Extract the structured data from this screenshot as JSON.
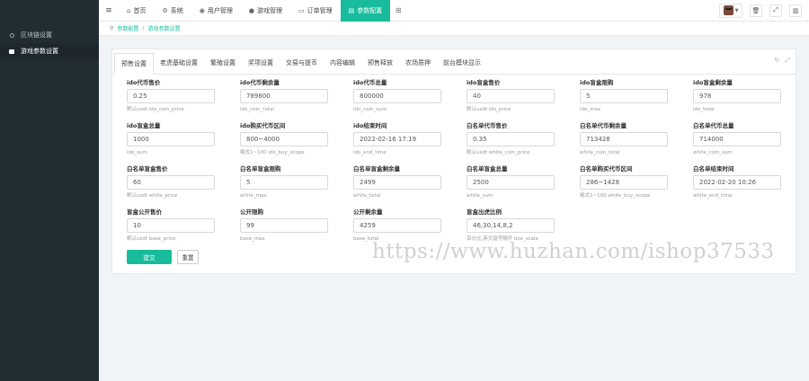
{
  "sidebar": {
    "items": [
      {
        "label": "区块链设置",
        "icon": "circle-icon",
        "active": false
      },
      {
        "label": "游戏参数设置",
        "icon": "box-icon",
        "active": true
      }
    ]
  },
  "topnav": {
    "items": [
      {
        "label": "首页",
        "icon": "home-icon",
        "glyph": "⌂",
        "active": false
      },
      {
        "label": "系统",
        "icon": "gear-icon",
        "glyph": "⚙",
        "active": false
      },
      {
        "label": "用户管理",
        "icon": "user-icon",
        "glyph": "◉",
        "active": false
      },
      {
        "label": "游戏管理",
        "icon": "game-icon",
        "glyph": "●",
        "active": false
      },
      {
        "label": "订单管理",
        "icon": "order-icon",
        "glyph": "▭",
        "active": false
      },
      {
        "label": "参数配置",
        "icon": "config-icon",
        "glyph": "▤",
        "active": true
      }
    ]
  },
  "breadcrumb": {
    "level1": "参数配置",
    "level2": "游戏参数设置"
  },
  "tabs": [
    "预售设置",
    "老虎基础设置",
    "繁殖设置",
    "奖项设置",
    "交易与提币",
    "内容编辑",
    "预售释放",
    "农场质押",
    "前台模块显示"
  ],
  "active_tab": 0,
  "fields": [
    {
      "label": "ido代币售价",
      "value": "0.25",
      "hint": "默认usdt ido_coin_price"
    },
    {
      "label": "ido代币剩余量",
      "value": "789800",
      "hint": "ido_coin_total"
    },
    {
      "label": "ido代币总量",
      "value": "800000",
      "hint": "ido_coin_sum"
    },
    {
      "label": "ido盲盒售价",
      "value": "40",
      "hint": "默认usdt ido_price"
    },
    {
      "label": "ido盲盒限购",
      "value": "5",
      "hint": "ido_max"
    },
    {
      "label": "ido盲盒剩余量",
      "value": "978",
      "hint": "ido_total"
    },
    {
      "label": "ido盲盒总量",
      "value": "1000",
      "hint": "ido_sum"
    },
    {
      "label": "ido购买代币区间",
      "value": "800~4000",
      "hint": "格式1~100 ido_buy_scope"
    },
    {
      "label": "ido结束时间",
      "value": "2022-02-16 17:19",
      "hint": "ido_end_time"
    },
    {
      "label": "白名单代币售价",
      "value": "0.35",
      "hint": "默认usdt white_coin_price"
    },
    {
      "label": "白名单代币剩余量",
      "value": "713428",
      "hint": "white_coin_total"
    },
    {
      "label": "白名单代币总量",
      "value": "714000",
      "hint": "white_coin_sum"
    },
    {
      "label": "白名单盲盒售价",
      "value": "60",
      "hint": "默认usdt white_price"
    },
    {
      "label": "白名单盲盒限购",
      "value": "5",
      "hint": "white_max"
    },
    {
      "label": "白名单盲盒剩余量",
      "value": "2499",
      "hint": "white_total"
    },
    {
      "label": "白名单盲盒总量",
      "value": "2500",
      "hint": "white_sum"
    },
    {
      "label": "白名单购买代币区间",
      "value": "286~1428",
      "hint": "格式1~100 white_buy_scope"
    },
    {
      "label": "白名单结束时间",
      "value": "2022-02-20 10:26",
      "hint": "white_end_time"
    },
    {
      "label": "盲盒公开售价",
      "value": "10",
      "hint": "默认usdt base_price"
    },
    {
      "label": "公开限购",
      "value": "99",
      "hint": "base_max"
    },
    {
      "label": "公开剩余量",
      "value": "4259",
      "hint": "base_total"
    },
    {
      "label": "盲盒出虎比例",
      "value": "46,30,14,8,2",
      "hint": "百分比,英文逗号隔开 box_scale"
    }
  ],
  "buttons": {
    "submit": "提交",
    "reset": "重置"
  },
  "watermark": "https://www.huzhan.com/ishop37533",
  "colors": {
    "accent": "#18bc9c",
    "sidebar": "#222d32"
  }
}
